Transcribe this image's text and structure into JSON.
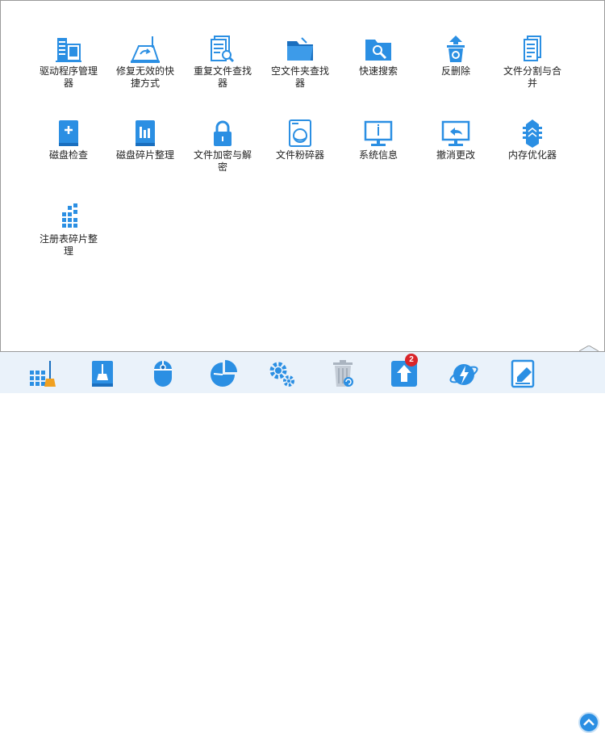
{
  "tools_row1": [
    {
      "label": "驱动程序管理器",
      "icon": "driver-manager-icon"
    },
    {
      "label": "修复无效的快捷方式",
      "icon": "shortcut-repair-icon"
    },
    {
      "label": "重复文件查找器",
      "icon": "duplicate-finder-icon"
    },
    {
      "label": "空文件夹查找器",
      "icon": "empty-folder-icon"
    },
    {
      "label": "快速搜索",
      "icon": "quick-search-icon"
    },
    {
      "label": "反删除",
      "icon": "undelete-icon"
    },
    {
      "label": "文件分割与合并",
      "icon": "file-split-icon"
    }
  ],
  "tools_row2": [
    {
      "label": "磁盘检查",
      "icon": "disk-check-icon"
    },
    {
      "label": "磁盘碎片整理",
      "icon": "disk-defrag-icon"
    },
    {
      "label": "文件加密与解密",
      "icon": "lock-icon"
    },
    {
      "label": "文件粉碎器",
      "icon": "shredder-icon"
    },
    {
      "label": "系统信息",
      "icon": "system-info-icon"
    },
    {
      "label": "撤消更改",
      "icon": "undo-changes-icon"
    },
    {
      "label": "内存优化器",
      "icon": "memory-optimizer-icon"
    }
  ],
  "tools_row3": [
    {
      "label": "注册表碎片整理",
      "icon": "registry-defrag-icon"
    }
  ],
  "bottom_bar": {
    "update_badge": "2",
    "accent": "#2b8fe3",
    "icons": [
      "cleaner-icon",
      "disk-clean-icon",
      "mouse-icon",
      "pie-chart-icon",
      "gears-icon",
      "recycle-bin-icon",
      "upload-icon",
      "internet-icon",
      "notes-icon"
    ]
  }
}
